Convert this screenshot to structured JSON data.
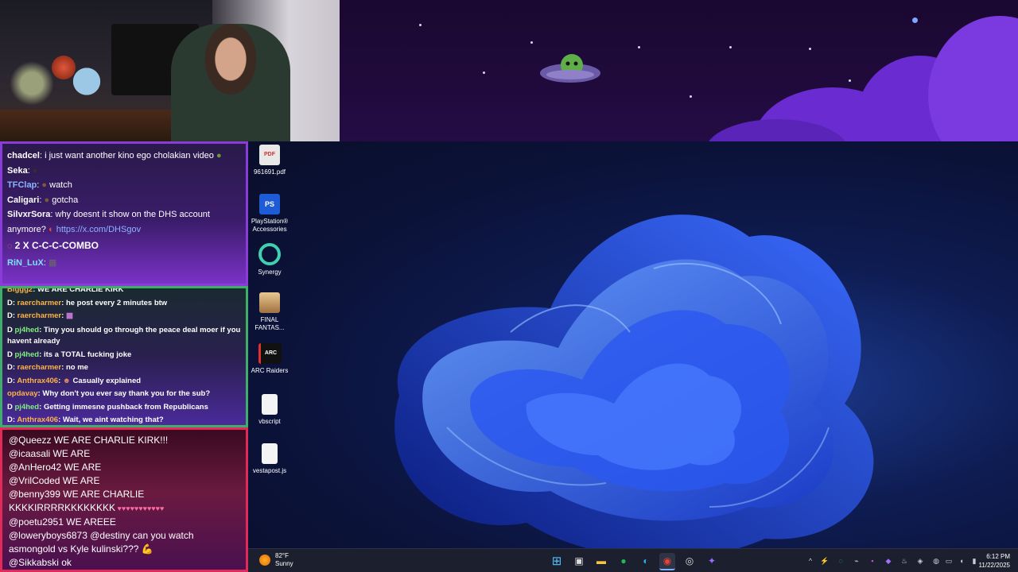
{
  "chat_top": {
    "lines": [
      {
        "user": "chadcel",
        "text": "i just want another kino ego cholakian video"
      },
      {
        "user": "Seka",
        "text": ""
      },
      {
        "user": "TFClap",
        "text": "watch"
      },
      {
        "user": "Caligari",
        "text": "gotcha"
      },
      {
        "user": "SilvxrSora",
        "text": "why doesnt it show on the DHS account"
      },
      {
        "user": "",
        "text": "anymore?",
        "link": "https://x.com/DHSgov"
      },
      {
        "user": "",
        "text": "2 X C-C-C-COMBO"
      },
      {
        "user": "RiN_LuX",
        "text": ""
      }
    ]
  },
  "chat_mid": {
    "lines": [
      {
        "user": "Biggg2",
        "text": "WE ARE CHARLIE KIRK"
      },
      {
        "user": "raercharmer",
        "text": "he post every 2 minutes btw"
      },
      {
        "user": "raercharmer",
        "text": ""
      },
      {
        "user": "pj4hed",
        "text": "Tiny you should go through the peace deal moer if you havent already"
      },
      {
        "user": "pj4hed",
        "text": "its a TOTAL fucking joke"
      },
      {
        "user": "raercharmer",
        "text": "no me"
      },
      {
        "user": "Anthrax406",
        "text": "Casually explained"
      },
      {
        "user": "opdavay",
        "text": "Why don't you ever say thank you for the sub?"
      },
      {
        "user": "pj4hed",
        "text": "Getting immesne pushback from Republicans"
      },
      {
        "user": "Anthrax406",
        "text": "Wait, we aint watching that?"
      }
    ]
  },
  "chat_bot": {
    "lines": [
      {
        "user": "@Queezz",
        "text": "WE ARE CHARLIE KIRK!!!"
      },
      {
        "user": "@icaasali",
        "text": "WE ARE"
      },
      {
        "user": "@AnHero42",
        "text": "WE ARE"
      },
      {
        "user": "@VrilCoded",
        "text": "WE ARE"
      },
      {
        "user": "@benny399",
        "text": "WE ARE CHARLIE KKKKIRRRRKKKKKKKK"
      },
      {
        "user": "@poetu2951",
        "text": "WE AREEE"
      },
      {
        "user": "@loweryboys6873",
        "text": "@destiny can you watch asmongold vs Kyle kulinski???"
      },
      {
        "user": "@Sikkabski",
        "text": "ok"
      }
    ]
  },
  "desktop_icons": [
    {
      "label": "961691.pdf",
      "icon": "pdf-file-icon",
      "glyph": "PDF",
      "color": "#e0e0e0",
      "text_color": "#d32f2f"
    },
    {
      "label": "PlayStation® Accessories",
      "icon": "playstation-icon",
      "glyph": "PS",
      "color": "#1e5bd6",
      "text_color": "#ffffff"
    },
    {
      "label": "Synergy",
      "icon": "synergy-icon",
      "glyph": "◯",
      "color": "#0e1c52",
      "text_color": "#3fd0b0"
    },
    {
      "label": "FINAL FANTAS...",
      "icon": "final-fantasy-icon",
      "glyph": "FF",
      "color": "#c8a060",
      "text_color": "#ffffff"
    },
    {
      "label": "ARC Raiders",
      "icon": "arc-raiders-icon",
      "glyph": "ARC",
      "color": "#111111",
      "text_color": "#ffffff"
    },
    {
      "label": "vbscript",
      "icon": "file-icon",
      "glyph": "",
      "color": "#f4f4f4",
      "text_color": "#333333"
    },
    {
      "label": "vestapost.js",
      "icon": "file-icon",
      "glyph": "",
      "color": "#f4f4f4",
      "text_color": "#333333"
    }
  ],
  "taskbar": {
    "weather_temp": "82°F",
    "weather_desc": "Sunny",
    "time": "6:12 PM",
    "date": "11/22/2025",
    "apps": [
      {
        "name": "start-button",
        "glyph": "⊞",
        "color": "#4fc3ff"
      },
      {
        "name": "task-view-button",
        "glyph": "▣",
        "color": "#dddddd"
      },
      {
        "name": "file-explorer-button",
        "glyph": "▬",
        "color": "#f5c542"
      },
      {
        "name": "spotify-button",
        "glyph": "●",
        "color": "#1db954"
      },
      {
        "name": "edge-button",
        "glyph": "◐",
        "color": "#2bb0e8"
      },
      {
        "name": "chrome-button",
        "glyph": "◉",
        "color": "#ea4335"
      },
      {
        "name": "obs-button",
        "glyph": "◎",
        "color": "#dddddd"
      },
      {
        "name": "app-button",
        "glyph": "✦",
        "color": "#9b6bff"
      }
    ],
    "tray": [
      {
        "name": "show-hidden-icons",
        "glyph": "^"
      },
      {
        "name": "tray-app-1-icon",
        "glyph": "⚡"
      },
      {
        "name": "tray-app-2-icon",
        "glyph": "◌"
      },
      {
        "name": "tray-app-3-icon",
        "glyph": "⌁"
      },
      {
        "name": "tray-app-4-icon",
        "glyph": "▪"
      },
      {
        "name": "tray-app-5-icon",
        "glyph": "◆"
      },
      {
        "name": "steam-tray-icon",
        "glyph": "♨"
      },
      {
        "name": "tray-app-6-icon",
        "glyph": "◈"
      },
      {
        "name": "tray-app-7-icon",
        "glyph": "◍"
      },
      {
        "name": "tray-app-8-icon",
        "glyph": "▤"
      },
      {
        "name": "network-icon",
        "glyph": "▭"
      },
      {
        "name": "volume-icon",
        "glyph": "◖"
      },
      {
        "name": "battery-icon",
        "glyph": "▮"
      }
    ]
  }
}
